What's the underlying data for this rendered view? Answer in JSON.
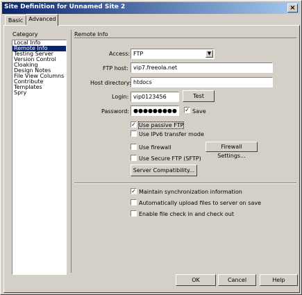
{
  "window": {
    "title": "Site Definition for Unnamed Site 2",
    "close": "×"
  },
  "tabs": [
    {
      "label": "Basic"
    },
    {
      "label": "Advanced"
    }
  ],
  "category": {
    "heading": "Category",
    "items": [
      "Local Info",
      "Remote Info",
      "Testing Server",
      "Version Control",
      "Cloaking",
      "Design Notes",
      "File View Columns",
      "Contribute",
      "Templates",
      "Spry"
    ],
    "selected": "Remote Info"
  },
  "remote_info": {
    "heading": "Remote Info",
    "access_label": "Access:",
    "access_value": "FTP",
    "ftp_host_label": "FTP host:",
    "ftp_host_value": "vip7.freeola.net",
    "host_dir_label": "Host directory:",
    "host_dir_value": "htdocs",
    "login_label": "Login:",
    "login_value": "vip0123456",
    "test_button": "Test",
    "password_label": "Password:",
    "password_value": "●●●●●●●●●",
    "save_label": "Save",
    "save_checked": true,
    "passive_label": "Use passive FTP",
    "passive_checked": true,
    "ipv6_label": "Use IPv6 transfer mode",
    "firewall_label": "Use firewall",
    "firewall_settings_button": "Firewall Settings...",
    "sftp_label": "Use Secure FTP (SFTP)",
    "server_compat_button": "Server Compatibility...",
    "maintain_sync_label": "Maintain synchronization information",
    "maintain_sync_checked": true,
    "auto_upload_label": "Automatically upload files to server on save",
    "checkin_label": "Enable file check in and check out"
  },
  "footer": {
    "ok": "OK",
    "cancel": "Cancel",
    "help": "Help"
  }
}
